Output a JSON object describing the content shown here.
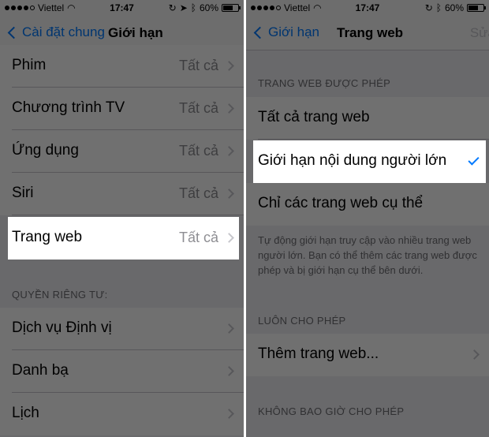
{
  "left": {
    "status": {
      "carrier": "Viettel",
      "time": "17:47",
      "battery": "60%",
      "battery_level": 0.6
    },
    "nav": {
      "back_label": "Cài đặt chung",
      "title": "Giới hạn"
    },
    "rows": [
      {
        "label": "Phim",
        "value": "Tất cả"
      },
      {
        "label": "Chương trình TV",
        "value": "Tất cả"
      },
      {
        "label": "Ứng dụng",
        "value": "Tất cả"
      },
      {
        "label": "Siri",
        "value": "Tất cả"
      },
      {
        "label": "Trang web",
        "value": "Tất cả"
      }
    ],
    "privacy_header": "QUYỀN RIÊNG TƯ:",
    "privacy_rows": [
      {
        "label": "Dịch vụ Định vị"
      },
      {
        "label": "Danh bạ"
      },
      {
        "label": "Lịch"
      }
    ]
  },
  "right": {
    "status": {
      "carrier": "Viettel",
      "time": "17:47",
      "battery": "60%",
      "battery_level": 0.6
    },
    "nav": {
      "back_label": "Giới hạn",
      "title": "Trang web",
      "action": "Sửa"
    },
    "allowed_header": "TRANG WEB ĐƯỢC PHÉP",
    "options": [
      {
        "label": "Tất cả trang web",
        "checked": false
      },
      {
        "label": "Giới hạn nội dung người lớn",
        "checked": true
      },
      {
        "label": "Chỉ các trang web cụ thể",
        "checked": false
      }
    ],
    "description": "Tự động giới hạn truy cập vào nhiều trang web người lớn. Bạn có thể thêm các trang web được phép và bị giới hạn cụ thể bên dưới.",
    "always_allow_header": "LUÔN CHO PHÉP",
    "add_site": "Thêm trang web...",
    "never_allow_header": "KHÔNG BAO GIỜ CHO PHÉP"
  },
  "colors": {
    "accent": "#007aff",
    "secondary_text": "#8e8e93",
    "background": "#efeff4"
  }
}
